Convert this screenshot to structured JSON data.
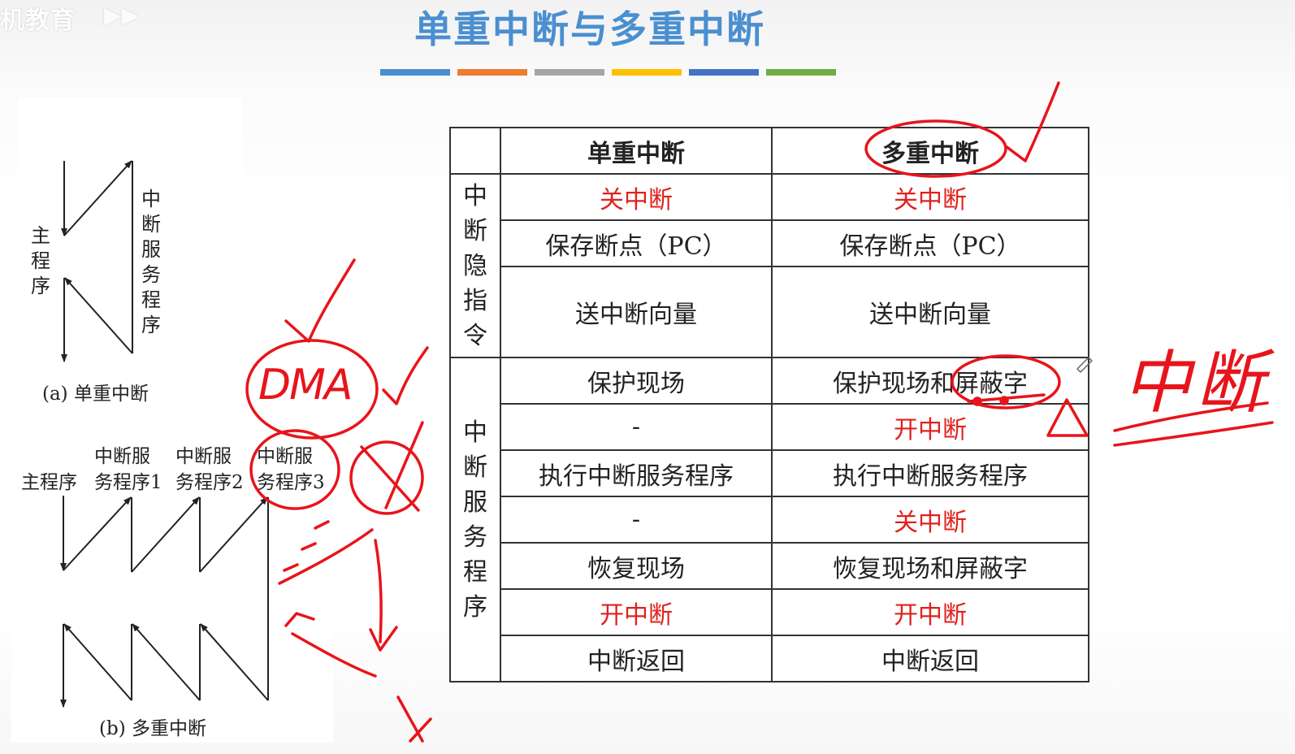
{
  "watermark": "机教育",
  "watermark2": "▶▶",
  "title": "单重中断与多重中断",
  "title_bar_colors": [
    "#4a8fd0",
    "#ed7d31",
    "#a5a5a5",
    "#ffc000",
    "#4472c4",
    "#70ad47"
  ],
  "figure_a": {
    "main_label": "主程序",
    "isr_label": "中断服务程序",
    "caption": "(a) 单重中断"
  },
  "figure_b": {
    "main_label": "主程序",
    "isr1_line1": "中断服",
    "isr1_line2": "务程序1",
    "isr2_line1": "中断服",
    "isr2_line2": "务程序2",
    "isr3_line1": "中断服",
    "isr3_line2": "务程序3",
    "caption": "(b) 多重中断"
  },
  "table": {
    "header_single": "单重中断",
    "header_multi": "多重中断",
    "group_hidden": "中断隐指令",
    "group_service": "中断服务程序",
    "rows": [
      {
        "single": "关中断",
        "multi": "关中断",
        "single_red": true,
        "multi_red": true
      },
      {
        "single": "保存断点（PC）",
        "multi": "保存断点（PC）",
        "single_red": false,
        "multi_red": false
      },
      {
        "single": "送中断向量",
        "multi": "送中断向量",
        "single_red": false,
        "multi_red": false
      },
      {
        "single": "保护现场",
        "multi": "保护现场和屏蔽字",
        "single_red": false,
        "multi_red": false
      },
      {
        "single": "-",
        "multi": "开中断",
        "single_red": false,
        "multi_red": true
      },
      {
        "single": "执行中断服务程序",
        "multi": "执行中断服务程序",
        "single_red": false,
        "multi_red": false
      },
      {
        "single": "-",
        "multi": "关中断",
        "single_red": false,
        "multi_red": true
      },
      {
        "single": "恢复现场",
        "multi": "恢复现场和屏蔽字",
        "single_red": false,
        "multi_red": false
      },
      {
        "single": "开中断",
        "multi": "开中断",
        "single_red": true,
        "multi_red": true
      },
      {
        "single": "中断返回",
        "multi": "中断返回",
        "single_red": false,
        "multi_red": false
      }
    ]
  },
  "annotations": {
    "dma": "DMA",
    "right_note": "中断",
    "ink_color": "#e8141b"
  }
}
